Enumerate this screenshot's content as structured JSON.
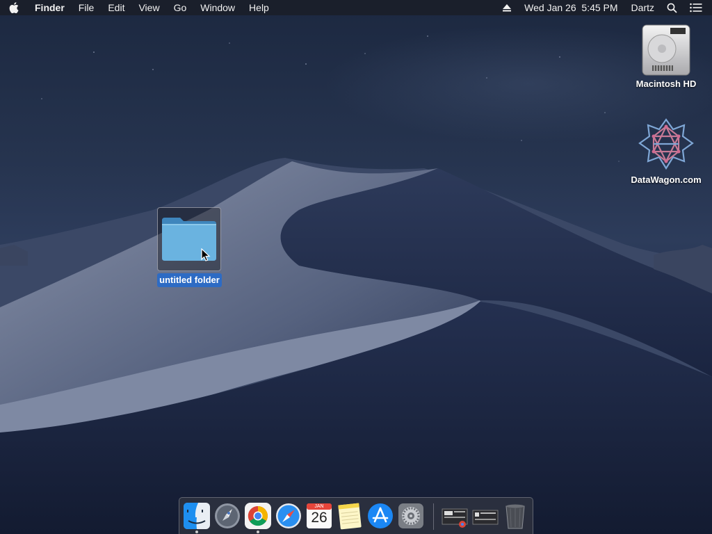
{
  "menubar": {
    "apple_icon": "apple-logo-icon",
    "app_name": "Finder",
    "menus": [
      "File",
      "Edit",
      "View",
      "Go",
      "Window",
      "Help"
    ],
    "eject_icon": "eject-icon",
    "datetime": "Wed Jan 26  5:45 PM",
    "user": "Dartz",
    "search_icon": "spotlight-search-icon",
    "notification_icon": "notification-center-icon"
  },
  "desktop": {
    "icons": [
      {
        "label": "Macintosh HD",
        "icon": "hard-drive-icon"
      },
      {
        "label": "DataWagon.com",
        "icon": "network-volume-icon"
      },
      {
        "label": "untitled folder",
        "icon": "folder-icon",
        "selected": true
      }
    ]
  },
  "dock": {
    "items": [
      {
        "label": "Finder",
        "icon": "finder-icon",
        "running": true
      },
      {
        "label": "Launchpad",
        "icon": "launchpad-icon",
        "running": false
      },
      {
        "label": "Google Chrome",
        "icon": "chrome-icon",
        "running": true
      },
      {
        "label": "Safari",
        "icon": "safari-icon",
        "running": false
      },
      {
        "label": "Calendar",
        "icon": "calendar-icon",
        "running": false,
        "month": "JAN",
        "day": "26"
      },
      {
        "label": "Notes",
        "icon": "notes-icon",
        "running": false
      },
      {
        "label": "App Store",
        "icon": "app-store-icon",
        "running": false
      },
      {
        "label": "System Preferences",
        "icon": "system-preferences-icon",
        "running": false
      }
    ],
    "minimized": [
      {
        "icon": "minimized-window-icon"
      },
      {
        "icon": "minimized-window-icon"
      }
    ],
    "trash_icon": "trash-icon"
  },
  "colors": {
    "selection": "#2d6bc4",
    "folder": "#6ab3e0",
    "menubar_bg": "#1a1e28"
  }
}
